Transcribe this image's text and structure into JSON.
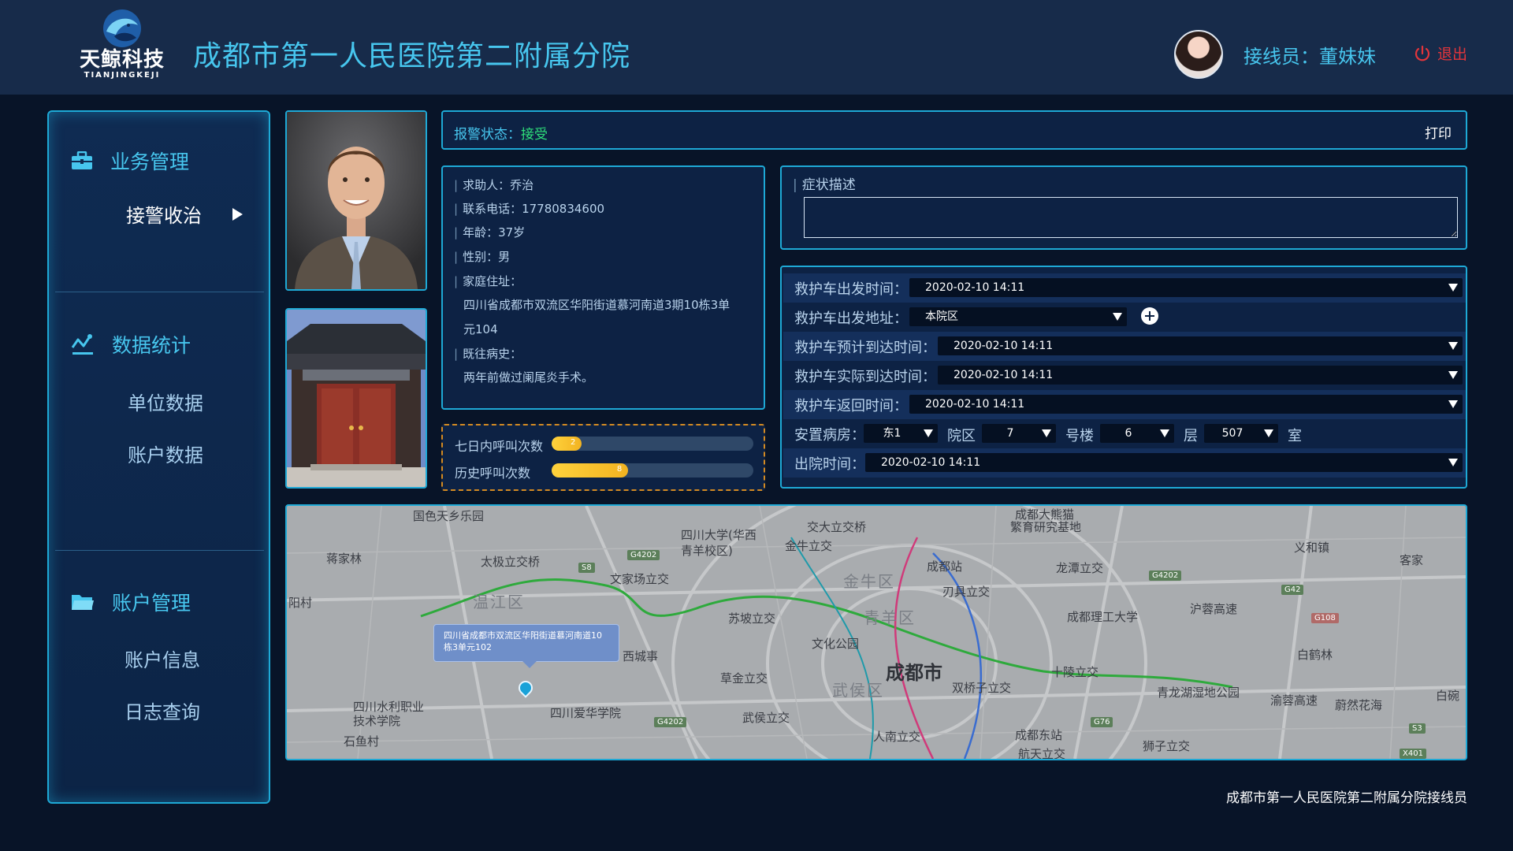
{
  "header": {
    "logo_name": "天鲸科技",
    "logo_sub": "TIANJINGKEJI",
    "title": "成都市第一人民医院第二附属分院",
    "operator_label": "接线员：",
    "operator_name": "董妹妹",
    "logout_label": "退出"
  },
  "sidebar": {
    "sections": [
      {
        "label": "业务管理",
        "icon": "briefcase-icon",
        "items": [
          {
            "label": "接警收治",
            "active": true
          }
        ]
      },
      {
        "label": "数据统计",
        "icon": "chart-icon",
        "items": [
          {
            "label": "单位数据"
          },
          {
            "label": "账户数据"
          }
        ]
      },
      {
        "label": "账户管理",
        "icon": "folder-icon",
        "items": [
          {
            "label": "账户信息"
          },
          {
            "label": "日志查询"
          }
        ]
      }
    ]
  },
  "status": {
    "label": "报警状态：",
    "value": "接受",
    "value_color": "#2fe07a",
    "print_label": "打印"
  },
  "patient": {
    "caller": "求助人：乔治",
    "phone": "联系电话：17780834600",
    "age": "年龄：37岁",
    "gender": "性别：男",
    "address_label": "家庭住址：",
    "address_line1": "四川省成都市双流区华阳街道慕河南道3期10栋3单",
    "address_line2": "元104",
    "history_label": "既往病史：",
    "history": "两年前做过阑尾炎手术。"
  },
  "calls": {
    "week_label": "七日内呼叫次数",
    "week_value": "2",
    "week_fraction": 0.15,
    "history_label": "历史呼叫次数",
    "history_value": "8",
    "history_fraction": 0.38
  },
  "symptom": {
    "label": "症状描述",
    "value": ""
  },
  "form": {
    "depart_time_label": "救护车出发时间：",
    "depart_time": "2020-02-10 14:11",
    "depart_addr_label": "救护车出发地址：",
    "depart_addr": "本院区",
    "eta_label": "救护车预计到达时间：",
    "eta": "2020-02-10 14:11",
    "arrive_label": "救护车实际到达时间：",
    "arrive": "2020-02-10 14:11",
    "return_label": "救护车返回时间：",
    "return_time": "2020-02-10 14:11",
    "ward_label": "安置病房：",
    "ward_area": "东1",
    "unit_area": "院区",
    "ward_building": "7",
    "unit_building": "号楼",
    "ward_floor": "6",
    "unit_floor": "层",
    "ward_room": "507",
    "unit_room": "室",
    "discharge_label": "出院时间：",
    "discharge": "2020-02-10 14:11"
  },
  "map": {
    "tooltip": "四川省成都市双流区华阳街道慕河南道10栋3单元102",
    "labels": [
      "国色天乡乐园",
      "四川大学(华西",
      "青羊校区)",
      "交大立交桥",
      "金牛立交",
      "成都大熊猫",
      "繁育研究基地",
      "义和镇",
      "客家",
      "蒋家林",
      "太极立交桥",
      "文家场立交",
      "成都站",
      "刃具立交",
      "龙潭立交",
      "温江区",
      "金牛区",
      "青羊区",
      "成都理工大学",
      "沪蓉高速",
      "阳村",
      "苏坡立交",
      "文化公园",
      "西城事",
      "成都市",
      "十陵立交",
      "白鹤林",
      "草金立交",
      "武侯区",
      "双桥子立交",
      "青龙湖湿地公园",
      "蔚然花海",
      "白碗",
      "四川水利职业",
      "技术学院",
      "四川爱华学院",
      "武侯立交",
      "成都东站",
      "渝蓉高速",
      "石鱼村",
      "人南立交",
      "狮子立交",
      "航天立交"
    ],
    "shields": [
      "G4202",
      "S8",
      "G4202",
      "G42",
      "G108",
      "G4202",
      "G76",
      "S3",
      "X401"
    ]
  },
  "footer": "成都市第一人民医院第二附属分院接线员"
}
